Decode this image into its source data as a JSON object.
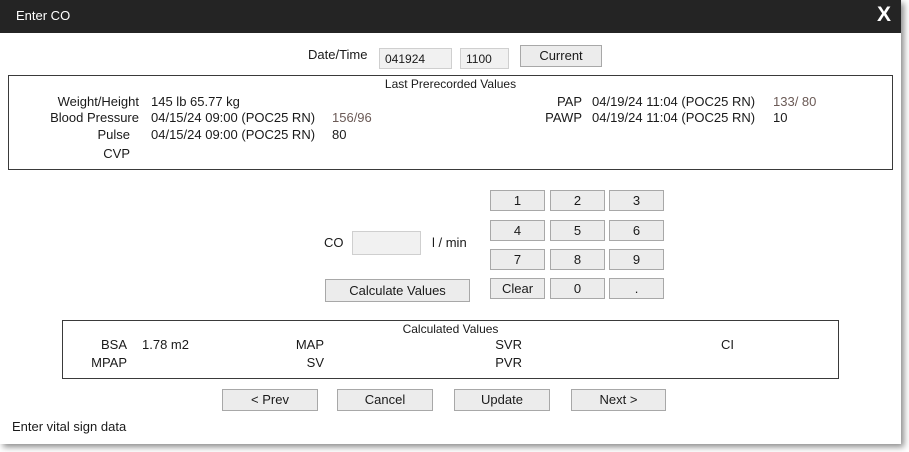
{
  "window": {
    "title": "Enter CO",
    "close_glyph": "X"
  },
  "datetime": {
    "label": "Date/Time",
    "date_value": "041924",
    "time_value": "1100",
    "current_button": "Current"
  },
  "last_prerecorded": {
    "title": "Last Prerecorded Values",
    "weight_height": {
      "label": "Weight/Height",
      "value": "145 lb 65.77 kg"
    },
    "blood_pressure": {
      "label": "Blood Pressure",
      "time": "04/15/24 09:00 (POC25 RN)",
      "value": "156/96"
    },
    "pulse": {
      "label": "Pulse",
      "time": "04/15/24 09:00 (POC25 RN)",
      "value": "80"
    },
    "cvp": {
      "label": "CVP"
    },
    "pap": {
      "label": "PAP",
      "time": "04/19/24 11:04 (POC25 RN)",
      "value": "133/ 80"
    },
    "pawp": {
      "label": "PAWP",
      "time": "04/19/24 11:04 (POC25 RN)",
      "value": "10"
    }
  },
  "co_entry": {
    "label": "CO",
    "value": "",
    "unit": "l / min",
    "calculate_button": "Calculate Values"
  },
  "keypad": {
    "keys": [
      "1",
      "2",
      "3",
      "4",
      "5",
      "6",
      "7",
      "8",
      "9",
      "Clear",
      "0",
      "."
    ]
  },
  "calculated": {
    "title": "Calculated Values",
    "bsa": {
      "label": "BSA",
      "value": "1.78 m2"
    },
    "mpap": {
      "label": "MPAP"
    },
    "map": {
      "label": "MAP"
    },
    "sv": {
      "label": "SV"
    },
    "svr": {
      "label": "SVR"
    },
    "pvr": {
      "label": "PVR"
    },
    "ci": {
      "label": "CI"
    }
  },
  "nav": {
    "prev": "< Prev",
    "cancel": "Cancel",
    "update": "Update",
    "next": "Next >"
  },
  "status": {
    "text": "Enter vital sign data"
  },
  "colors": {
    "titlebar": "#242424",
    "value_accent": "#6b5a56"
  }
}
